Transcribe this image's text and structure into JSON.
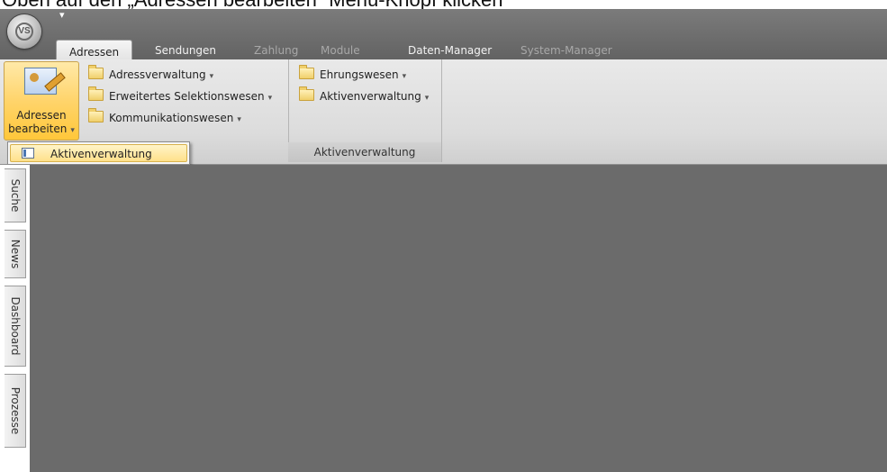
{
  "caption": "Oben auf den „Adressen bearbeiten“ Menü-Knopf klicken",
  "app": {
    "orb_icon": "app-orb-logo-icon",
    "orb_text": "VS"
  },
  "tabs": [
    {
      "label": "Adressen",
      "state": "active"
    },
    {
      "label": "Sendungen",
      "state": "enabled"
    },
    {
      "label": "Zahlung",
      "state": "disabled"
    },
    {
      "label": "Module",
      "state": "disabled"
    },
    {
      "label": "Daten-Manager",
      "state": "enabled"
    },
    {
      "label": "System-Manager",
      "state": "disabled"
    }
  ],
  "ribbon": {
    "group1": {
      "big_button": {
        "line1": "Adressen",
        "line2": "bearbeiten",
        "icon": "edit-address-icon"
      },
      "items": [
        {
          "label": "Adressverwaltung",
          "icon": "folder-icon"
        },
        {
          "label": "Erweitertes Selektionswesen",
          "icon": "folder-icon"
        },
        {
          "label": "Kommunikationswesen",
          "icon": "folder-icon"
        }
      ]
    },
    "group2": {
      "label": "Aktivenverwaltung",
      "items": [
        {
          "label": "Ehrungswesen",
          "icon": "folder-icon"
        },
        {
          "label": "Aktivenverwaltung",
          "icon": "folder-icon"
        }
      ]
    }
  },
  "dropdown": {
    "items": [
      {
        "label": "Aktivenverwaltung",
        "icon": "window-icon",
        "highlighted": true
      }
    ]
  },
  "side_tabs": [
    "Suche",
    "News",
    "Dashboard",
    "Prozesse"
  ],
  "colors": {
    "ribbon_bg": "#dcdcdc",
    "tabbar_bg": "#6b6b6b",
    "highlight": "#ffd46b",
    "workspace_bg": "#6b6b6b"
  }
}
